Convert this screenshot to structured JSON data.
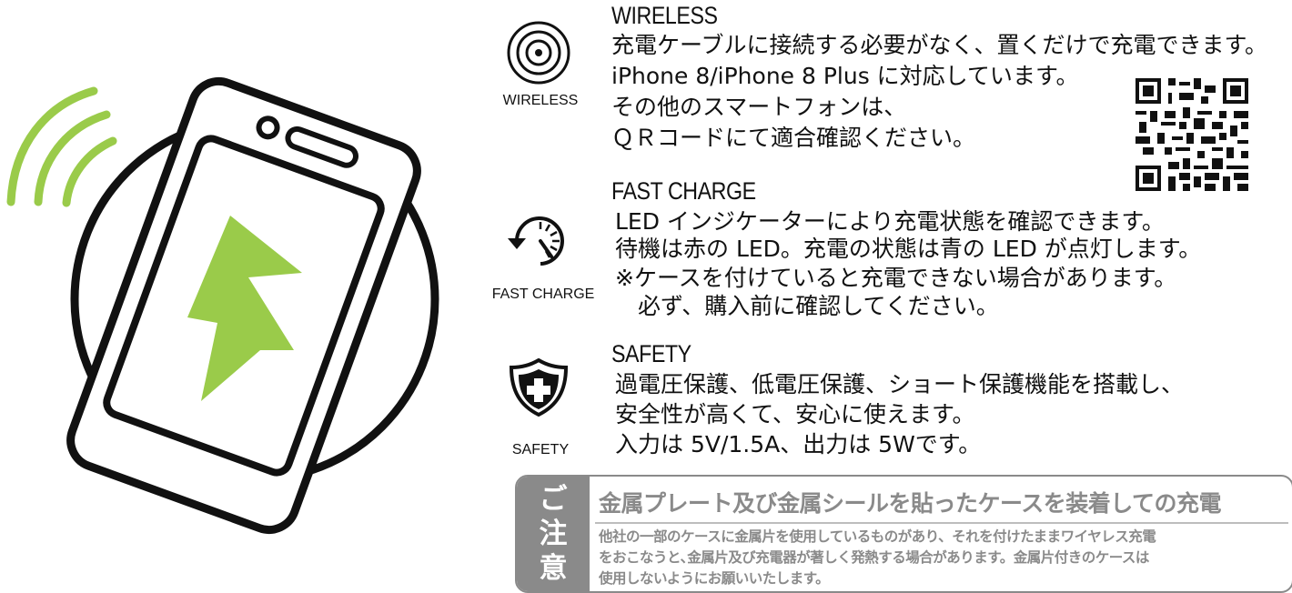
{
  "colors": {
    "accent_green": "#9acb4a",
    "notice_gray": "#8a8a8a",
    "ink": "#111111"
  },
  "illustration": {
    "icons": [
      "wireless-signal-icon",
      "charging-pad",
      "smartphone",
      "lightning-bolt-icon"
    ]
  },
  "features": [
    {
      "icon": "wireless-target-icon",
      "caption": "WIRELESS",
      "title": "WIRELESS",
      "lines": [
        "充電ケーブルに接続する必要がなく、置くだけで充電できます。",
        "iPhone 8/iPhone 8 Plus に対応しています。",
        "その他のスマートフォンは、",
        "ＱＲコードにて適合確認ください。"
      ]
    },
    {
      "icon": "fast-charge-gauge-icon",
      "caption": "FAST CHARGE",
      "title": "FAST CHARGE",
      "lines": [
        "LED インジケーターにより充電状態を確認できます。",
        "待機は赤の LED。充電の状態は青の LED が点灯します。",
        "※ケースを付けていると充電できない場合があります。",
        "　必ず、購入前に確認してください。"
      ]
    },
    {
      "icon": "safety-shield-cross-icon",
      "caption": "SAFETY",
      "title": "SAFETY",
      "lines": [
        "過電圧保護、低電圧保護、ショート保護機能を搭載し、",
        "安全性が高くて、安心に使えます。",
        "入力は 5V/1.5A、出力は 5Wです。"
      ]
    }
  ],
  "qr_code": {
    "icon": "qr-code"
  },
  "notice": {
    "tag_chars": [
      "ご",
      "注",
      "意"
    ],
    "title": "金属プレート及び金属シールを貼ったケースを装着しての充電",
    "lines": [
      "他社の一部のケースに金属片を使用しているものがあり、それを付けたままワイヤレス充電",
      "をおこなうと､金属片及び充電器が著しく発熱する場合があります。金属片付きのケースは",
      "使用しないようにお願いいたします。"
    ]
  }
}
